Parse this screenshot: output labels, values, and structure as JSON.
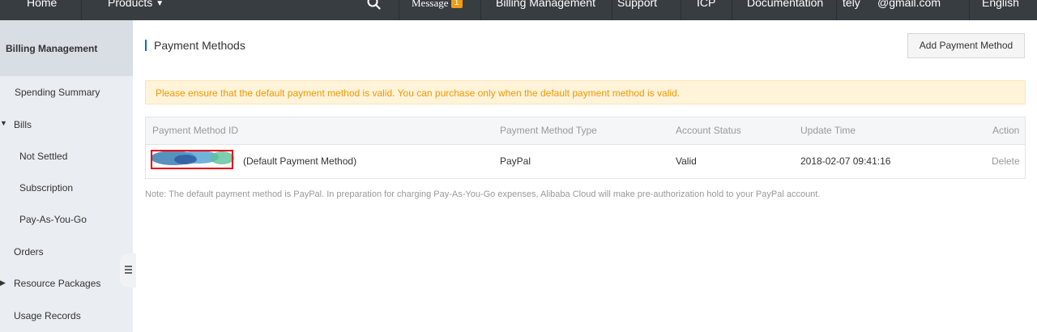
{
  "topnav": {
    "home": "Home",
    "products": "Products",
    "message_label": "Message",
    "message_count": "1",
    "billing": "Billing Management",
    "support": "Support",
    "icp": "ICP",
    "documentation": "Documentation",
    "user_name": "tely",
    "user_email": "@gmail.com",
    "language": "English"
  },
  "sidebar": {
    "title": "Billing Management",
    "items": {
      "spending_summary": "Spending Summary",
      "bills": "Bills",
      "not_settled": "Not Settled",
      "subscription": "Subscription",
      "pay_as_you_go": "Pay-As-You-Go",
      "orders": "Orders",
      "resource_packages": "Resource Packages",
      "usage_records": "Usage Records"
    }
  },
  "main": {
    "title": "Payment Methods",
    "add_button": "Add Payment Method",
    "notice": "Please ensure that the default payment method is valid. You can purchase only when the default payment method is valid.",
    "table": {
      "headers": {
        "id": "Payment Method ID",
        "type": "Payment Method Type",
        "status": "Account Status",
        "update_time": "Update Time",
        "action": "Action"
      },
      "row": {
        "id_suffix": "(Default Payment Method)",
        "type": "PayPal",
        "status": "Valid",
        "update_time": "2018-02-07 09:41:16",
        "action": "Delete"
      }
    },
    "note": "Note: The default payment method is PayPal. In preparation for charging Pay-As-You-Go expenses, Alibaba Cloud will make pre-authorization hold to your PayPal account."
  },
  "colors": {
    "nav_bg": "#373d41",
    "sidebar_bg": "#eaedf1",
    "notice_text": "#f39800",
    "accent": "#0070cc",
    "highlight": "#e60012"
  }
}
